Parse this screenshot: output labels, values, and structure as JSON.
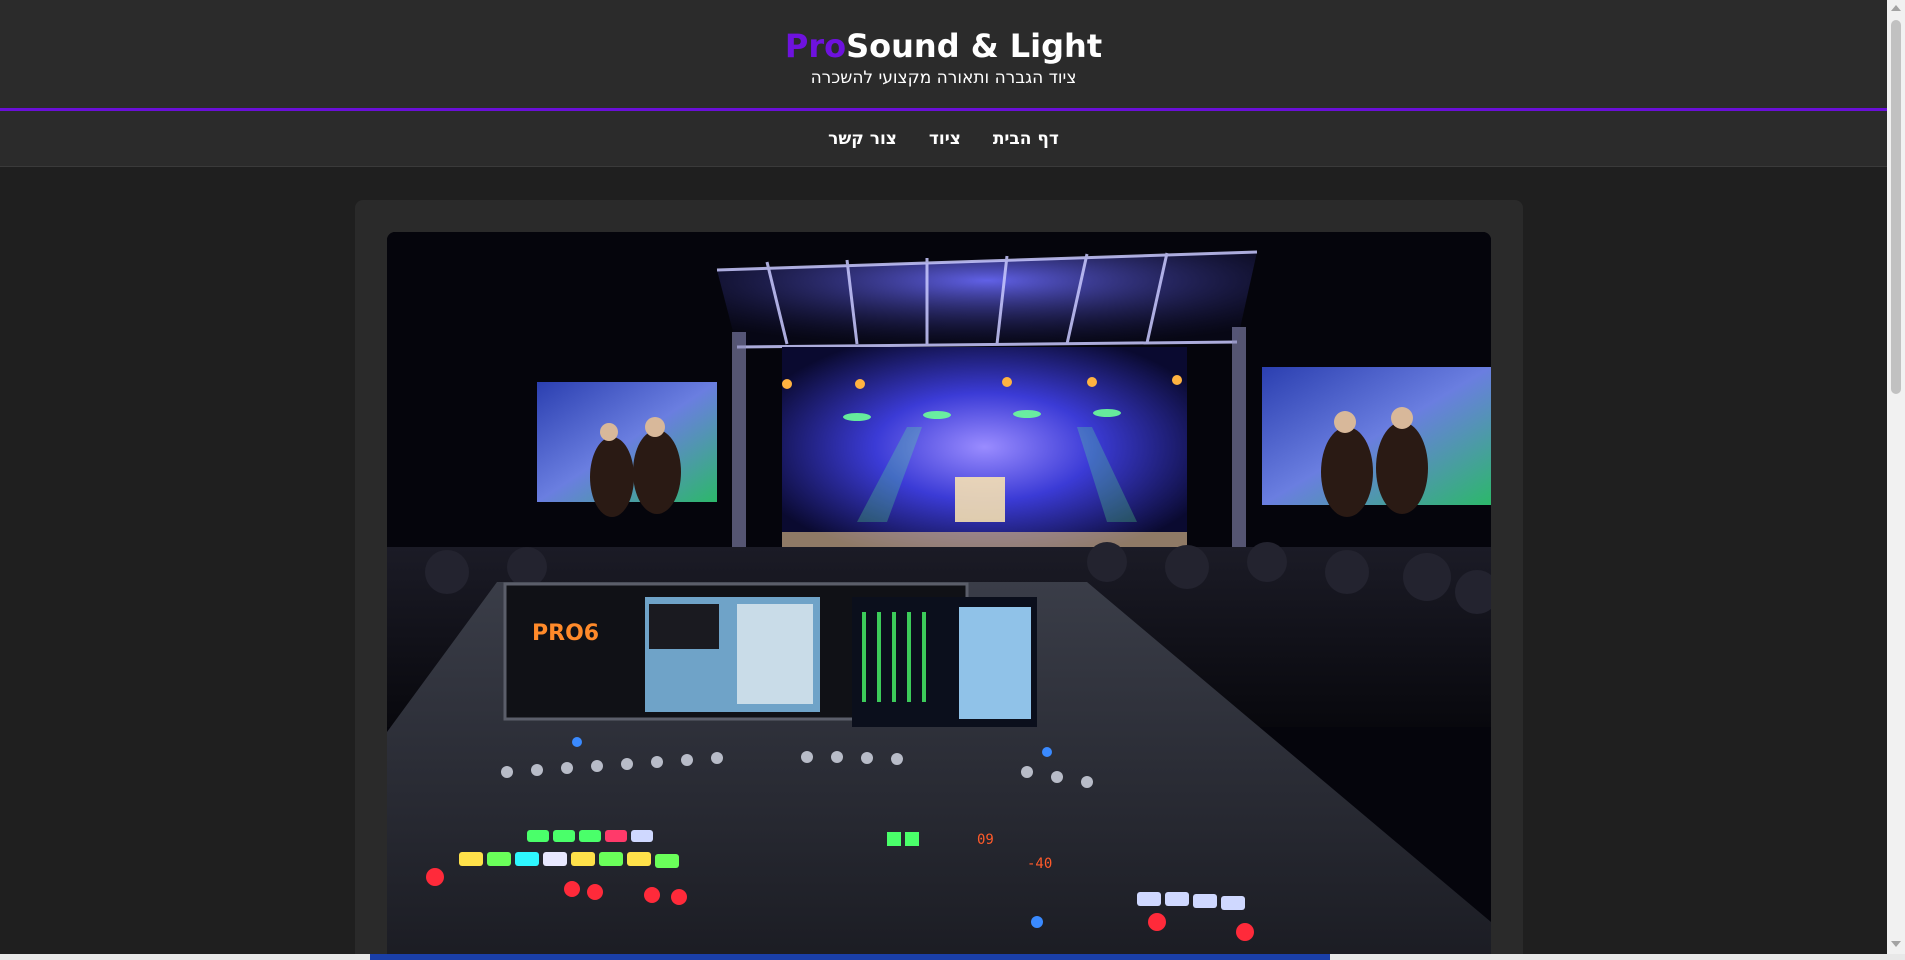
{
  "header": {
    "logo_accent": "Pro",
    "logo_rest": "Sound & Light",
    "tagline": "ציוד הגברה ותאורה מקצועי להשכרה"
  },
  "nav": {
    "items": [
      {
        "label": "דף הבית"
      },
      {
        "label": "ציוד"
      },
      {
        "label": "צור קשר"
      }
    ]
  },
  "hero": {
    "console_brand": "PRO6",
    "meter_left": "09",
    "meter_right": "-40"
  },
  "colors": {
    "accent": "#6e12de",
    "header_bg": "#2b2b2b",
    "page_bg": "#1f1f1f"
  }
}
